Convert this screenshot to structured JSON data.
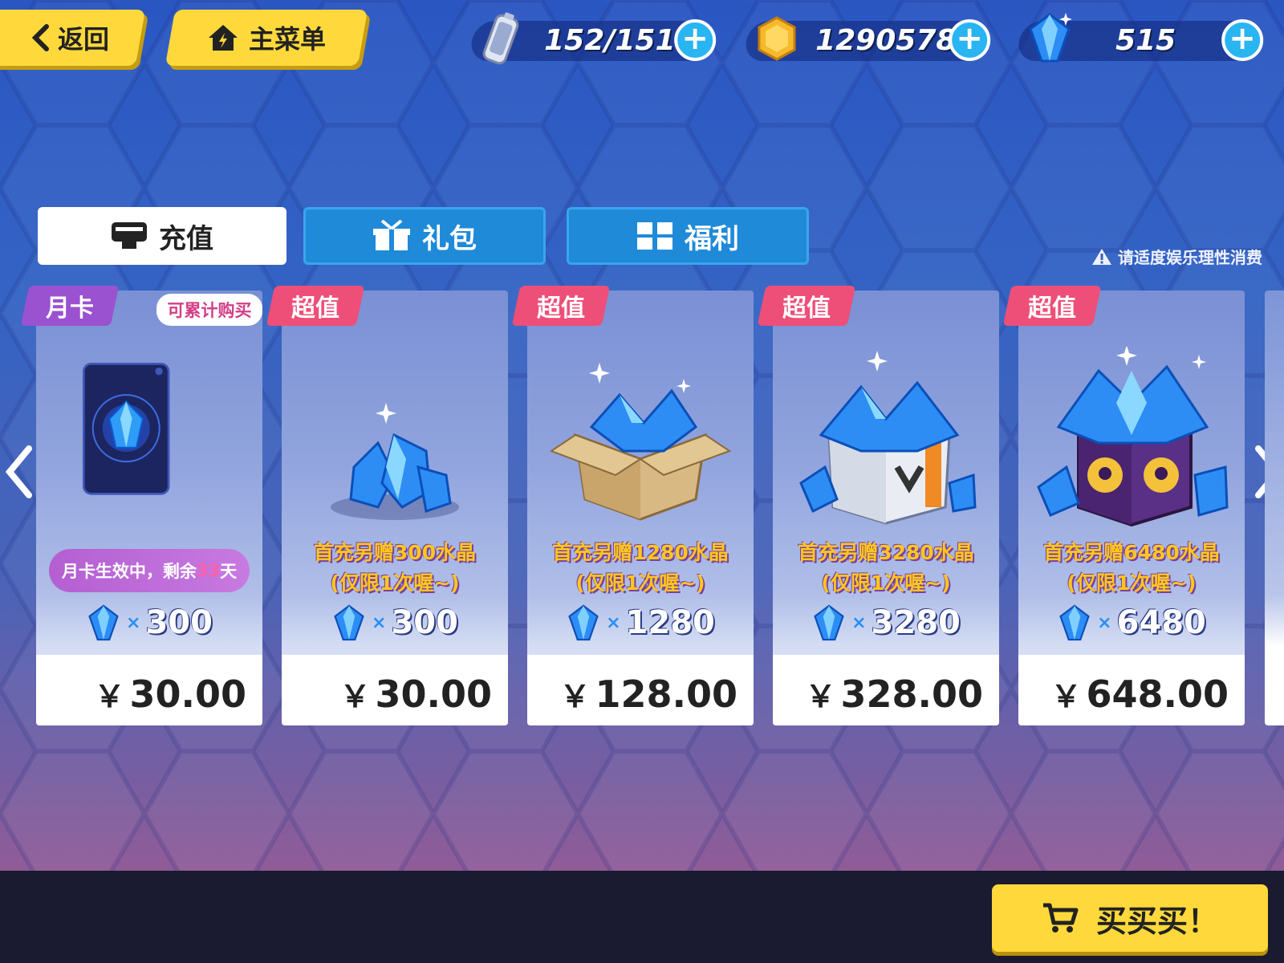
{
  "topbar": {
    "back_label": "返回",
    "home_label": "主菜单",
    "stamina": "152/151",
    "coins": "1290578",
    "crystals": "515"
  },
  "tabs": [
    {
      "label": "充值",
      "active": true
    },
    {
      "label": "礼包",
      "active": false
    },
    {
      "label": "福利",
      "active": false
    }
  ],
  "notice": "请适度娱乐理性消费",
  "cards": [
    {
      "tag": "月卡",
      "stack_label": "可累计购买",
      "status_prefix": "月卡生效中，剩余",
      "status_days": "33",
      "status_suffix": "天",
      "qty_x": "×",
      "qty": "300",
      "currency": "￥",
      "price": "30.00"
    },
    {
      "tag": "超值",
      "promo_line1": "首充另赠300水晶",
      "promo_line2": "(仅限1次喔~)",
      "qty_x": "×",
      "qty": "300",
      "currency": "￥",
      "price": "30.00"
    },
    {
      "tag": "超值",
      "promo_line1": "首充另赠1280水晶",
      "promo_line2": "(仅限1次喔~)",
      "qty_x": "×",
      "qty": "1280",
      "currency": "￥",
      "price": "128.00"
    },
    {
      "tag": "超值",
      "promo_line1": "首充另赠3280水晶",
      "promo_line2": "(仅限1次喔~)",
      "qty_x": "×",
      "qty": "3280",
      "currency": "￥",
      "price": "328.00"
    },
    {
      "tag": "超值",
      "promo_line1": "首充另赠6480水晶",
      "promo_line2": "(仅限1次喔~)",
      "qty_x": "×",
      "qty": "6480",
      "currency": "￥",
      "price": "648.00"
    }
  ],
  "buy_label": "买买买！",
  "colors": {
    "accent_yellow": "#ffd93b",
    "tag_pink": "#ee4f78",
    "tag_purple": "#9a52d0",
    "tab_blue": "#1f8ad8",
    "plus_blue": "#29b4f2",
    "promo_gold": "#ffc71c"
  },
  "icons": {
    "back": "chevron-left-icon",
    "home": "home-icon",
    "stamina": "battery-icon",
    "coin": "coin-icon",
    "crystal": "crystal-icon",
    "tab_recharge": "card-reader-icon",
    "tab_gift": "gift-icon",
    "tab_welfare": "welfare-icon",
    "warning": "warning-icon",
    "cart": "cart-icon",
    "carousel_left": "chevron-left-icon",
    "carousel_right": "chevron-right-icon"
  }
}
